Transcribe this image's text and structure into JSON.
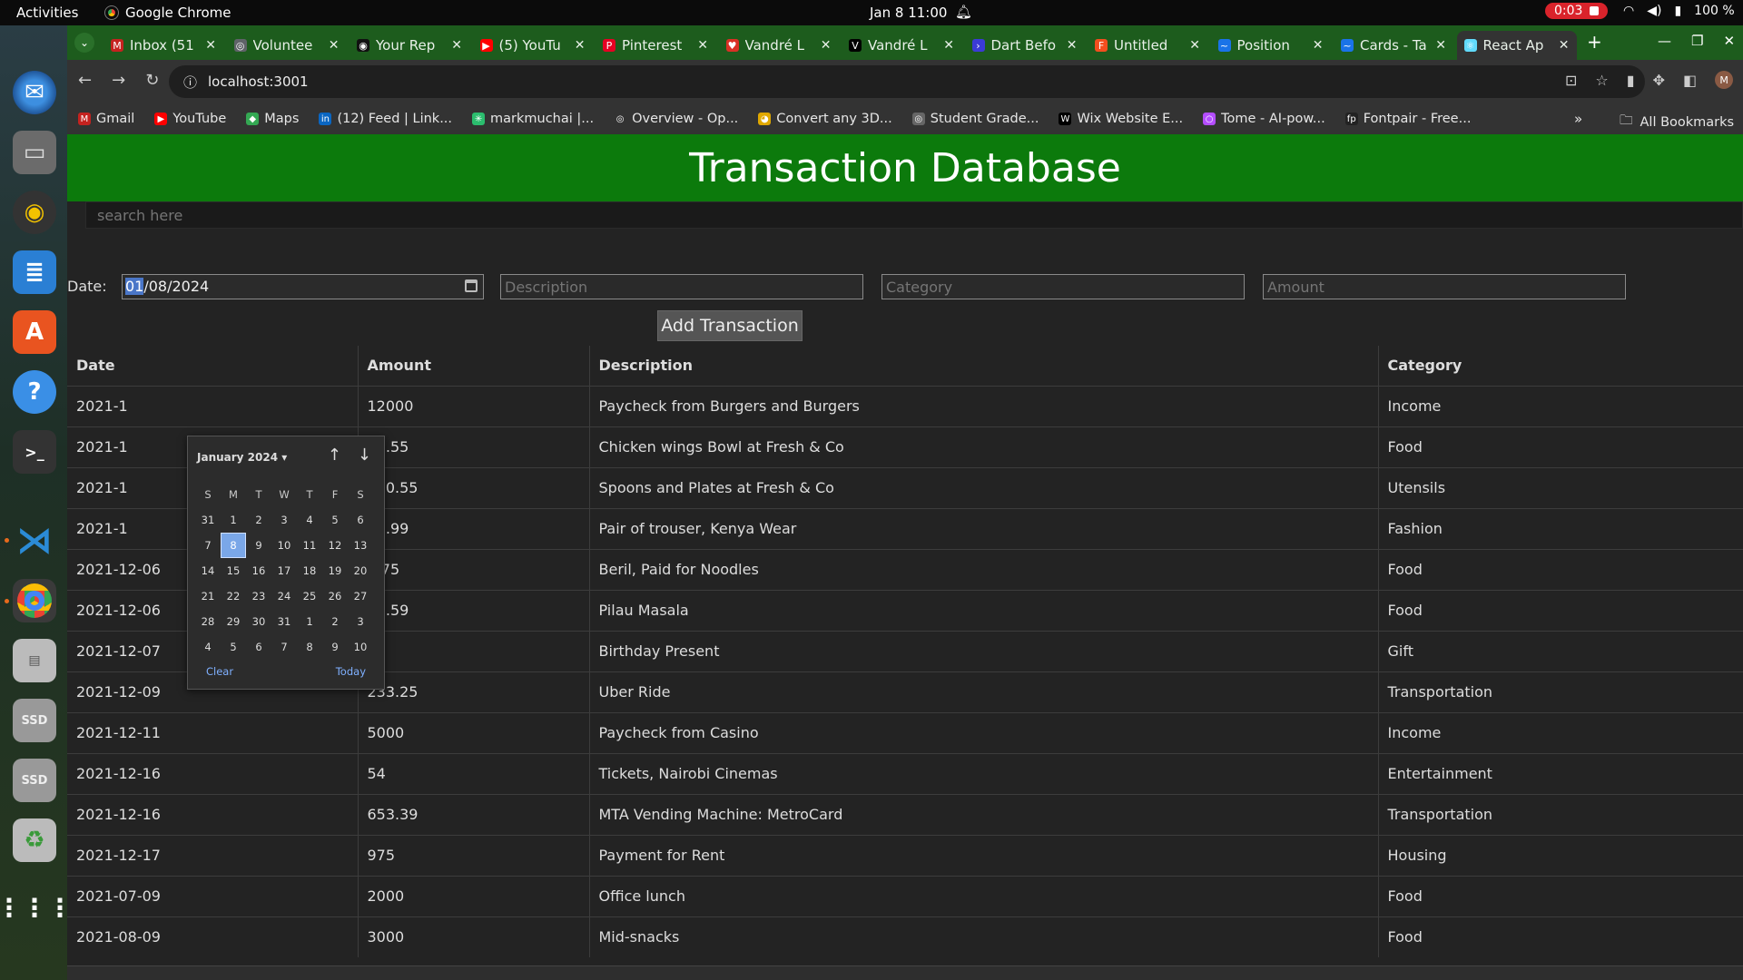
{
  "os": {
    "activities": "Activities",
    "app_name": "Google Chrome",
    "clock": "Jan 8  11:00",
    "recording": "0:03",
    "battery": "100 %"
  },
  "tabs": [
    {
      "label": "Inbox (51",
      "fav": "M",
      "color": "#c5221f"
    },
    {
      "label": "Voluntee",
      "fav": "◎",
      "color": "#5f6368"
    },
    {
      "label": "Your Rep",
      "fav": "◉",
      "color": "#111111"
    },
    {
      "label": "(5) YouTu",
      "fav": "▶",
      "color": "#ff0000"
    },
    {
      "label": "Pinterest",
      "fav": "P",
      "color": "#e60023"
    },
    {
      "label": "Vandré L",
      "fav": "♥",
      "color": "#d93025"
    },
    {
      "label": "Vandré L",
      "fav": "V",
      "color": "#000000"
    },
    {
      "label": "Dart Befo",
      "fav": "›",
      "color": "#3b3bd6"
    },
    {
      "label": "Untitled",
      "fav": "F",
      "color": "#f24e1e"
    },
    {
      "label": "Position",
      "fav": "~",
      "color": "#1a73e8"
    },
    {
      "label": "Cards - Ta",
      "fav": "~",
      "color": "#1a73e8"
    },
    {
      "label": "React Ap",
      "fav": "⚛",
      "color": "#61dafb"
    }
  ],
  "url": "localhost:3001",
  "bookmarks": [
    {
      "label": "Gmail",
      "icon": "M",
      "color": "#c5221f"
    },
    {
      "label": "YouTube",
      "icon": "▶",
      "color": "#ff0000"
    },
    {
      "label": "Maps",
      "icon": "◆",
      "color": "#34a853"
    },
    {
      "label": "(12) Feed | Link...",
      "icon": "in",
      "color": "#0a66c2"
    },
    {
      "label": "markmuchai |...",
      "icon": "✳",
      "color": "#2bbd6e"
    },
    {
      "label": "Overview - Op...",
      "icon": "◎",
      "color": "#333333"
    },
    {
      "label": "Convert any 3D...",
      "icon": "◕",
      "color": "#e0a800"
    },
    {
      "label": "Student Grade...",
      "icon": "◎",
      "color": "#666666"
    },
    {
      "label": "Wix Website E...",
      "icon": "W",
      "color": "#000000"
    },
    {
      "label": "Tome - AI-pow...",
      "icon": "○",
      "color": "#b44dff"
    },
    {
      "label": "Fontpair - Free...",
      "icon": "fp",
      "color": "#222222"
    }
  ],
  "all_bookmarks": "All Bookmarks",
  "app": {
    "title": "Transaction Database",
    "search_placeholder": "search here",
    "date_label": "Date:",
    "date_value_sel": "01",
    "date_value_rest": "/08/2024",
    "description_placeholder": "Description",
    "category_placeholder": "Category",
    "amount_placeholder": "Amount",
    "add_button": "Add Transaction",
    "columns": [
      "Date",
      "Amount",
      "Description",
      "Category"
    ],
    "rows": [
      [
        "2021-1",
        "12000",
        "Paycheck from Burgers and Burgers",
        "Income"
      ],
      [
        "2021-1",
        "10.55",
        "Chicken wings Bowl at Fresh & Co",
        "Food"
      ],
      [
        "2021-1",
        "200.55",
        "Spoons and Plates at Fresh & Co",
        "Utensils"
      ],
      [
        "2021-1",
        "34.99",
        "Pair of trouser, Kenya Wear",
        "Fashion"
      ],
      [
        "2021-12-06",
        "8.75",
        "Beril, Paid for Noodles",
        "Food"
      ],
      [
        "2021-12-06",
        "37.59",
        "Pilau Masala",
        "Food"
      ],
      [
        "2021-12-07",
        "50",
        "Birthday Present",
        "Gift"
      ],
      [
        "2021-12-09",
        "233.25",
        "Uber Ride",
        "Transportation"
      ],
      [
        "2021-12-11",
        "5000",
        "Paycheck from Casino",
        "Income"
      ],
      [
        "2021-12-16",
        "54",
        "Tickets, Nairobi Cinemas",
        "Entertainment"
      ],
      [
        "2021-12-16",
        "653.39",
        "MTA Vending Machine: MetroCard",
        "Transportation"
      ],
      [
        "2021-12-17",
        "975",
        "Payment for Rent",
        "Housing"
      ],
      [
        "2021-07-09",
        "2000",
        "Office lunch",
        "Food"
      ],
      [
        "2021-08-09",
        "3000",
        "Mid-snacks",
        "Food"
      ]
    ]
  },
  "datepicker": {
    "month_label": "January 2024 ▾",
    "weekdays": [
      "S",
      "M",
      "T",
      "W",
      "T",
      "F",
      "S"
    ],
    "days": [
      "31",
      "1",
      "2",
      "3",
      "4",
      "5",
      "6",
      "7",
      "8",
      "9",
      "10",
      "11",
      "12",
      "13",
      "14",
      "15",
      "16",
      "17",
      "18",
      "19",
      "20",
      "21",
      "22",
      "23",
      "24",
      "25",
      "26",
      "27",
      "28",
      "29",
      "30",
      "31",
      "1",
      "2",
      "3",
      "4",
      "5",
      "6",
      "7",
      "8",
      "9",
      "10"
    ],
    "selected": "8",
    "clear": "Clear",
    "today": "Today"
  }
}
